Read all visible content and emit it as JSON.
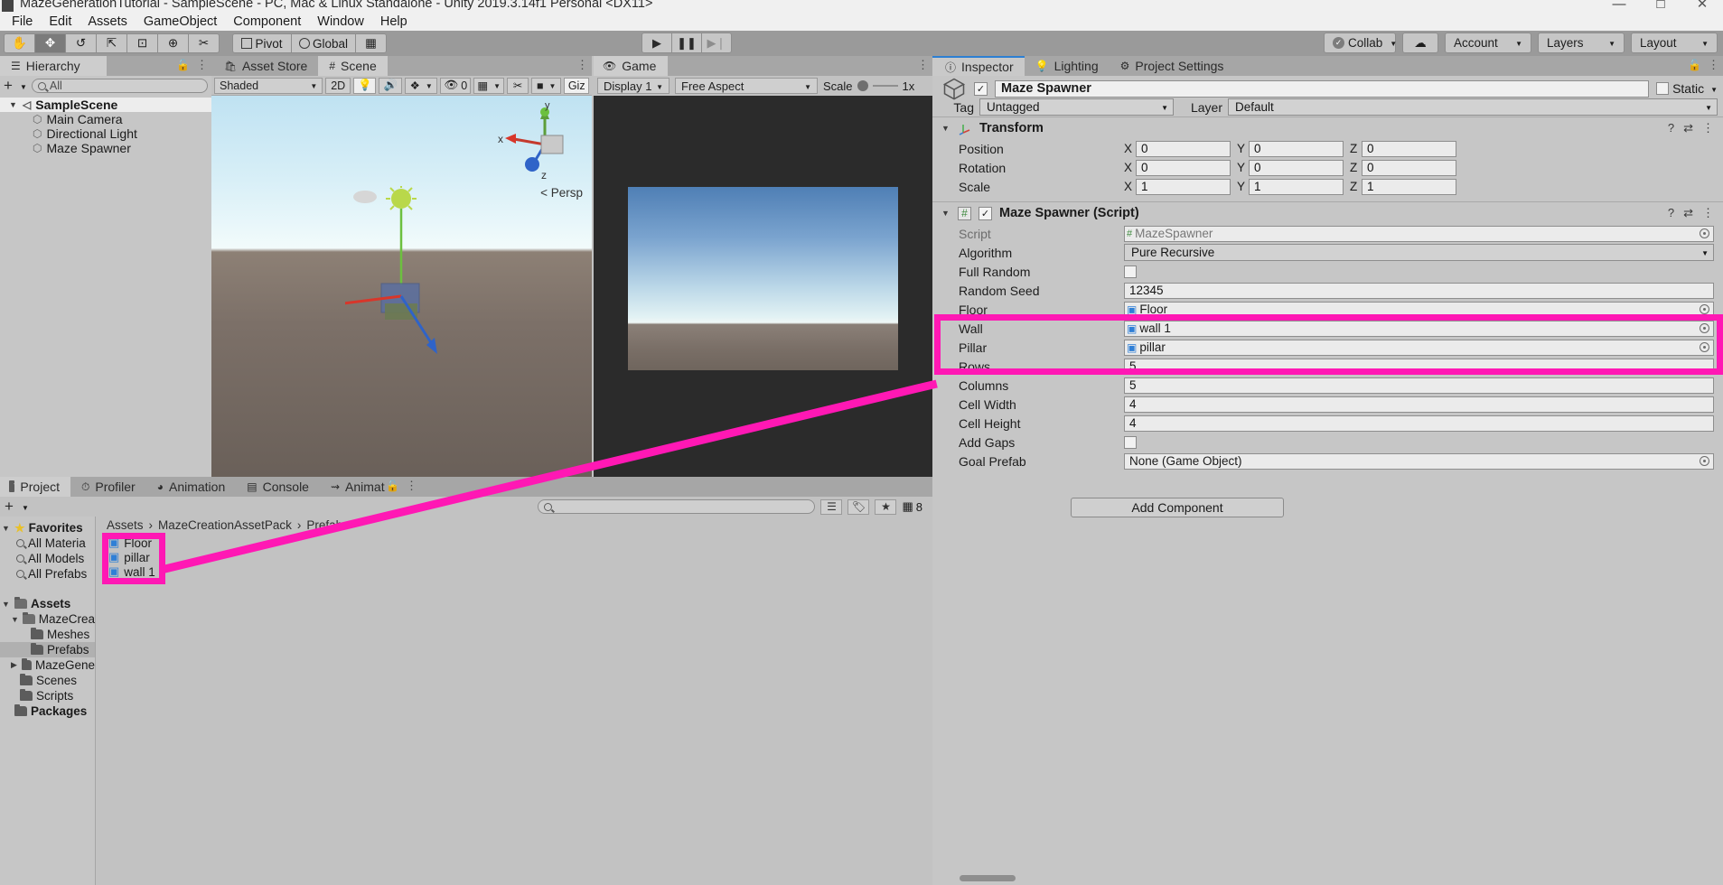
{
  "window": {
    "title": "MazeGenerationTutorial - SampleScene - PC, Mac & Linux Standalone - Unity 2019.3.14f1 Personal <DX11>",
    "minimize": "—",
    "maximize": "□",
    "close": "✕"
  },
  "menu": {
    "items": [
      "File",
      "Edit",
      "Assets",
      "GameObject",
      "Component",
      "Window",
      "Help"
    ]
  },
  "toolbar": {
    "tools": [
      {
        "name": "hand-tool",
        "glyph": "✋",
        "active": false
      },
      {
        "name": "move-tool",
        "glyph": "✥",
        "active": true
      },
      {
        "name": "rotate-tool",
        "glyph": "↺",
        "active": false
      },
      {
        "name": "scale-tool",
        "glyph": "⇱",
        "active": false
      },
      {
        "name": "rect-tool",
        "glyph": "⊡",
        "active": false
      },
      {
        "name": "transform-tool",
        "glyph": "⊕",
        "active": false
      },
      {
        "name": "custom-tool",
        "glyph": "✂",
        "active": false
      }
    ],
    "pivot": "Pivot",
    "global": "Global",
    "grid": "▦",
    "play": "▶",
    "pause": "❚❚",
    "step": "▶❘",
    "collab": "Collab",
    "cloud": "☁",
    "account": "Account",
    "layers": "Layers",
    "layout": "Layout"
  },
  "hierarchy": {
    "tab": "Hierarchy",
    "add": "+",
    "search_placeholder": "All",
    "items": [
      {
        "label": "SampleScene",
        "depth": 0,
        "selected": true,
        "icon": "scene-icon"
      },
      {
        "label": "Main Camera",
        "depth": 1,
        "selected": false,
        "icon": "gameobject-icon"
      },
      {
        "label": "Directional Light",
        "depth": 1,
        "selected": false,
        "icon": "gameobject-icon"
      },
      {
        "label": "Maze Spawner",
        "depth": 1,
        "selected": false,
        "icon": "gameobject-icon"
      }
    ]
  },
  "scene": {
    "tabs": [
      {
        "label": "Asset Store",
        "active": false
      },
      {
        "label": "Scene",
        "active": true
      }
    ],
    "shading": "Shaded",
    "mode2d": "2D",
    "effects_count": "0",
    "gizmos": "Giz",
    "persp_label": "Persp",
    "axis_x": "x",
    "axis_y": "y",
    "axis_z": "z"
  },
  "game": {
    "tab": "Game",
    "display": "Display 1",
    "aspect": "Free Aspect",
    "scale_label": "Scale",
    "scale_value": "1x"
  },
  "inspector": {
    "tabs": [
      {
        "label": "Inspector",
        "active": true,
        "icon": "info-icon"
      },
      {
        "label": "Lighting",
        "active": false,
        "icon": "light-icon"
      },
      {
        "label": "Project Settings",
        "active": false,
        "icon": "gear-icon"
      }
    ],
    "object_name": "Maze Spawner",
    "object_enabled": true,
    "static_label": "Static",
    "tag_label": "Tag",
    "tag_value": "Untagged",
    "layer_label": "Layer",
    "layer_value": "Default",
    "transform": {
      "title": "Transform",
      "rows": [
        {
          "name": "Position",
          "x": "0",
          "y": "0",
          "z": "0"
        },
        {
          "name": "Rotation",
          "x": "0",
          "y": "0",
          "z": "0"
        },
        {
          "name": "Scale",
          "x": "1",
          "y": "1",
          "z": "1"
        }
      ]
    },
    "script_component": {
      "title": "Maze Spawner (Script)",
      "enabled": true,
      "properties": [
        {
          "name": "Script",
          "type": "object",
          "value": "MazeSpawner",
          "icon": "script-icon",
          "dim": true
        },
        {
          "name": "Algorithm",
          "type": "dropdown",
          "value": "Pure Recursive"
        },
        {
          "name": "Full Random",
          "type": "checkbox",
          "value": false
        },
        {
          "name": "Random Seed",
          "type": "text",
          "value": "12345"
        },
        {
          "name": "Floor",
          "type": "object",
          "value": "Floor",
          "icon": "prefab-icon",
          "highlight": true
        },
        {
          "name": "Wall",
          "type": "object",
          "value": "wall 1",
          "icon": "prefab-icon",
          "highlight": true
        },
        {
          "name": "Pillar",
          "type": "object",
          "value": "pillar",
          "icon": "prefab-icon",
          "highlight": true
        },
        {
          "name": "Rows",
          "type": "text",
          "value": "5"
        },
        {
          "name": "Columns",
          "type": "text",
          "value": "5"
        },
        {
          "name": "Cell Width",
          "type": "text",
          "value": "4"
        },
        {
          "name": "Cell Height",
          "type": "text",
          "value": "4"
        },
        {
          "name": "Add Gaps",
          "type": "checkbox",
          "value": false
        },
        {
          "name": "Goal Prefab",
          "type": "object",
          "value": "None (Game Object)",
          "icon": "none-icon"
        }
      ]
    },
    "add_component": "Add Component"
  },
  "project": {
    "tabs": [
      {
        "label": "Project",
        "active": true,
        "icon": "folder-icon"
      },
      {
        "label": "Profiler",
        "active": false,
        "icon": "profiler-icon"
      },
      {
        "label": "Animation",
        "active": false,
        "icon": "clock-icon"
      },
      {
        "label": "Console",
        "active": false,
        "icon": "console-icon"
      },
      {
        "label": "Animat",
        "active": false,
        "icon": "animator-icon"
      }
    ],
    "add": "+",
    "search_placeholder": "",
    "icon_count": "8",
    "tree": [
      {
        "label": "Favorites",
        "depth": 0,
        "tri": "▾",
        "icon": "star-icon",
        "bold": true
      },
      {
        "label": "All Materia",
        "depth": 1,
        "tri": "",
        "icon": "search-icon"
      },
      {
        "label": "All Models",
        "depth": 1,
        "tri": "",
        "icon": "search-icon"
      },
      {
        "label": "All Prefabs",
        "depth": 1,
        "tri": "",
        "icon": "search-icon"
      },
      {
        "label": "",
        "depth": 0,
        "tri": "",
        "icon": "spacer"
      },
      {
        "label": "Assets",
        "depth": 0,
        "tri": "▾",
        "icon": "folder-open-icon",
        "bold": true
      },
      {
        "label": "MazeCrea",
        "depth": 1,
        "tri": "▾",
        "icon": "folder-open-icon"
      },
      {
        "label": "Meshes",
        "depth": 2,
        "tri": "",
        "icon": "folder-icon"
      },
      {
        "label": "Prefabs",
        "depth": 2,
        "tri": "",
        "icon": "folder-icon",
        "selected": true
      },
      {
        "label": "MazeGene",
        "depth": 1,
        "tri": "▸",
        "icon": "folder-icon"
      },
      {
        "label": "Scenes",
        "depth": 1,
        "tri": "",
        "icon": "folder-icon"
      },
      {
        "label": "Scripts",
        "depth": 1,
        "tri": "",
        "icon": "folder-icon"
      },
      {
        "label": "Packages",
        "depth": 0,
        "tri": "",
        "icon": "folder-icon",
        "bold": true
      }
    ],
    "breadcrumb": [
      "Assets",
      "MazeCreationAssetPack",
      "Prefabs"
    ],
    "assets": [
      {
        "label": "Floor",
        "icon": "prefab-icon"
      },
      {
        "label": "pillar",
        "icon": "prefab-icon"
      },
      {
        "label": "wall 1",
        "icon": "prefab-icon"
      }
    ]
  },
  "annotations": {
    "accent_color": "#ff18b4",
    "highlight_inspector": "Floor / Wall / Pillar object fields",
    "highlight_project": "Floor / pillar / wall 1 prefabs"
  }
}
